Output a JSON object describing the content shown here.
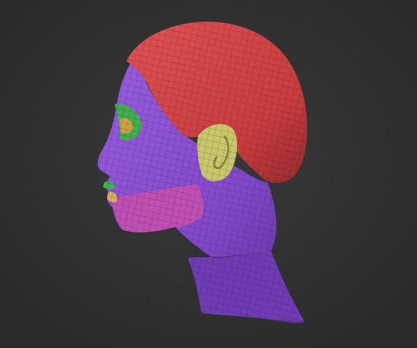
{
  "scene": {
    "subject": "head-model",
    "colors": {
      "background": "#2e2e2e",
      "background_center": "#3a3a3a",
      "skin_group": "#8a4fd0",
      "skin_shadow": "#5e2f9a",
      "hair_group": "#d24545",
      "hair_shadow": "#9e2e30",
      "ear_group": "#c8c86a",
      "jaw_group": "#c050b0",
      "eye_group": "#3fb04a",
      "lip_group": "#d8b050",
      "wireframe": "#1a1030"
    }
  }
}
